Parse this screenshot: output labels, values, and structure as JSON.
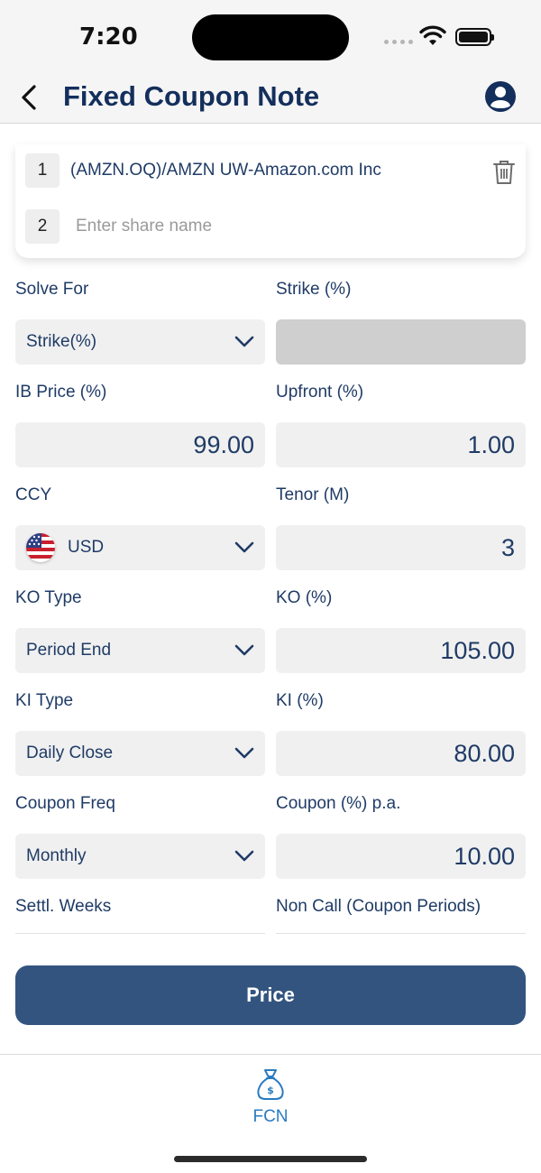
{
  "status_bar": {
    "time": "7:20"
  },
  "nav": {
    "title": "Fixed Coupon Note"
  },
  "shares": [
    {
      "index": "1",
      "name": "(AMZN.OQ)/AMZN UW-Amazon.com Inc"
    },
    {
      "index": "2",
      "value": "",
      "placeholder": "Enter share name"
    }
  ],
  "form": {
    "solve_for": {
      "label": "Solve For",
      "value": "Strike(%)"
    },
    "strike": {
      "label": "Strike (%)",
      "value": ""
    },
    "ib_price": {
      "label": "IB Price (%)",
      "value": "99.00"
    },
    "upfront": {
      "label": "Upfront (%)",
      "value": "1.00"
    },
    "ccy": {
      "label": "CCY",
      "value": "USD"
    },
    "tenor": {
      "label": "Tenor (M)",
      "value": "3"
    },
    "ko_type": {
      "label": "KO Type",
      "value": "Period End"
    },
    "ko": {
      "label": "KO (%)",
      "value": "105.00"
    },
    "ki_type": {
      "label": "KI Type",
      "value": "Daily Close"
    },
    "ki": {
      "label": "KI (%)",
      "value": "80.00"
    },
    "coupon_freq": {
      "label": "Coupon Freq",
      "value": "Monthly"
    },
    "coupon": {
      "label": "Coupon (%) p.a.",
      "value": "10.00"
    },
    "settl_weeks": {
      "label": "Settl. Weeks"
    },
    "non_call": {
      "label": "Non Call (Coupon Periods)"
    }
  },
  "price_button": {
    "label": "Price"
  },
  "tab_bar": {
    "items": [
      {
        "label": "FCN",
        "icon": "money-bag-icon"
      }
    ]
  },
  "colors": {
    "primary": "#142f5c",
    "button": "#33547f",
    "tab_active": "#2a7bc0",
    "field_bg": "#f0f0f0",
    "disabled_bg": "#cfcfcf"
  }
}
